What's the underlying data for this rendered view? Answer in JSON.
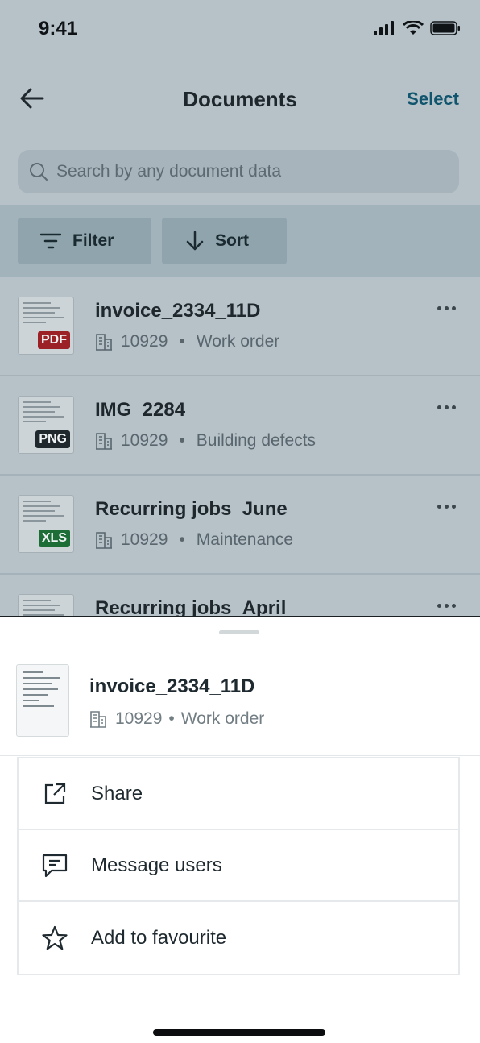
{
  "status_bar": {
    "time": "9:41"
  },
  "header": {
    "title": "Documents",
    "select_label": "Select"
  },
  "search": {
    "placeholder": "Search by any document data"
  },
  "toolbar": {
    "filter_label": "Filter",
    "sort_label": "Sort"
  },
  "documents": [
    {
      "name": "invoice_2334_11D",
      "id": "10929",
      "category": "Work order",
      "type": "PDF",
      "type_color": "#9b2127"
    },
    {
      "name": "IMG_2284",
      "id": "10929",
      "category": "Building defects",
      "type": "PNG",
      "type_color": "#1e282d"
    },
    {
      "name": "Recurring jobs_June",
      "id": "10929",
      "category": "Maintenance",
      "type": "XLS",
      "type_color": "#1d6d37"
    },
    {
      "name": "Recurring jobs_April",
      "id": "",
      "category": "",
      "type": "",
      "type_color": ""
    }
  ],
  "sheet": {
    "title": "invoice_2334_11D",
    "id": "10929",
    "category": "Work order",
    "separator": "•",
    "actions": [
      {
        "label": "Share",
        "icon": "share-external-icon"
      },
      {
        "label": "Message users",
        "icon": "message-icon"
      },
      {
        "label": "Add to favourite",
        "icon": "star-icon"
      }
    ]
  },
  "separator": "•",
  "colors": {
    "accent": "#10556d",
    "overlay_bg": "#b6c1c8"
  }
}
